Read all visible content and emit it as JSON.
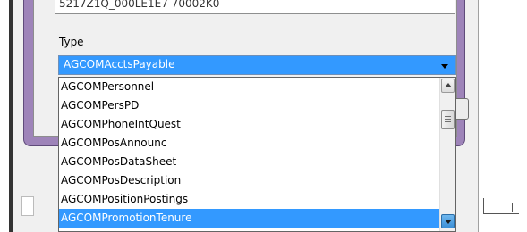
{
  "dialog": {
    "previous_field_value": "5217Z1Q_000LE1E7 70002K0",
    "type_label": "Type",
    "type_selected": "AGCOMAcctsPayable"
  },
  "dropdown": {
    "items": [
      {
        "label": "AGCOMPersonnel",
        "selected": false
      },
      {
        "label": "AGCOMPersPD",
        "selected": false
      },
      {
        "label": "AGCOMPhoneIntQuest",
        "selected": false
      },
      {
        "label": "AGCOMPosAnnounc",
        "selected": false
      },
      {
        "label": "AGCOMPosDataSheet",
        "selected": false
      },
      {
        "label": "AGCOMPosDescription",
        "selected": false
      },
      {
        "label": "AGCOMPositionPostings",
        "selected": false
      },
      {
        "label": "AGCOMPromotionTenure",
        "selected": true
      }
    ]
  },
  "colors": {
    "selection": "#3399ff",
    "dialog_frame": "#9e84b9"
  },
  "icons": {
    "combo_arrow": "chevron-down-icon",
    "scroll_up": "scroll-up-arrow-icon",
    "scroll_down": "scroll-down-arrow-icon"
  }
}
